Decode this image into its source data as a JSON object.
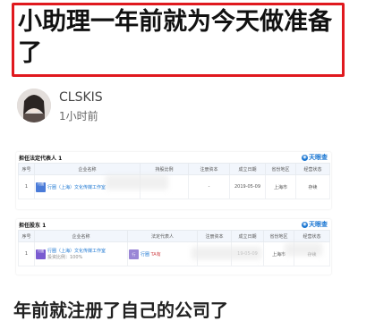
{
  "article": {
    "title_line1": "小助理一年前就为今天做准备",
    "title_line2": "了",
    "accent_color": "#e0191e"
  },
  "author": {
    "name": "CLSKIS",
    "time": "1小时前"
  },
  "brand": {
    "name": "天眼查",
    "color": "#1a76d2"
  },
  "legal_rep_section": {
    "title": "担任法定代表人 1",
    "headers": [
      "序号",
      "企业名称",
      "持股比例",
      "注册资本",
      "成立日期",
      "省份地区",
      "经营状态"
    ],
    "rows": [
      {
        "index": "1",
        "logo": "行圈",
        "name": "行圈（上海）文化传媒工作室",
        "ratio": "",
        "capital": "-",
        "date": "2019-05-09",
        "region": "上海市",
        "status": "存续"
      }
    ]
  },
  "shareholder_section": {
    "title": "担任股东 1",
    "headers": [
      "序号",
      "企业名称",
      "法定代表人",
      "注册资本",
      "成立日期",
      "省份地区",
      "经营状态"
    ],
    "rows": [
      {
        "index": "1",
        "logo": "行圈",
        "name": "行圈（上海）文化传媒工作室",
        "sub": "投资比例：100%",
        "rep_badge": "行",
        "rep_name": "行圈",
        "rep_tag": "TA有",
        "capital": "",
        "date": "19-05-09",
        "region": "上海市",
        "status": "存续"
      }
    ]
  },
  "body": {
    "partial_line": "年前就注册了自己的公司了"
  }
}
